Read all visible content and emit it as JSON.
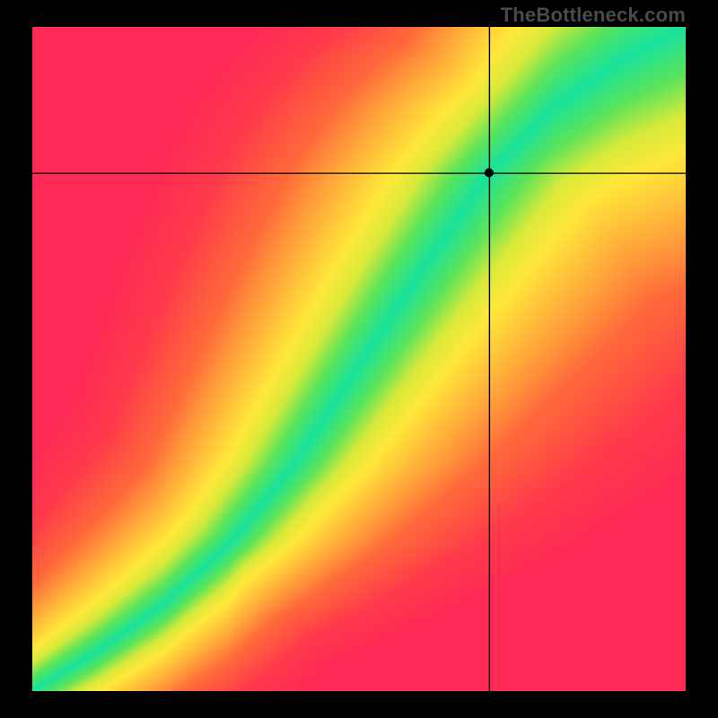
{
  "watermark": {
    "text": "TheBottleneck.com"
  },
  "chart_data": {
    "type": "heatmap",
    "title": "",
    "xlabel": "",
    "ylabel": "",
    "x_range": [
      0,
      1
    ],
    "y_range": [
      0,
      1
    ],
    "grid": false,
    "legend": false,
    "crosshair": {
      "x": 0.7,
      "y": 0.78
    },
    "marker": {
      "x": 0.7,
      "y": 0.78,
      "shape": "circle",
      "color": "#000000"
    },
    "ridge_curve_description": "Optimal match curve starts at origin, bends upward with GPU/CPU tradeoff, forming a diagonal green corridor widening toward upper right.",
    "color_scale": {
      "name": "bottleneck-red-yellow-green",
      "stops": [
        {
          "distance": 0.0,
          "color": "#18e29c"
        },
        {
          "distance": 0.06,
          "color": "#5ae45a"
        },
        {
          "distance": 0.12,
          "color": "#d7e93a"
        },
        {
          "distance": 0.18,
          "color": "#ffe83a"
        },
        {
          "distance": 0.28,
          "color": "#ffb83a"
        },
        {
          "distance": 0.45,
          "color": "#ff6a3a"
        },
        {
          "distance": 0.7,
          "color": "#ff3a4a"
        },
        {
          "distance": 1.0,
          "color": "#ff2a55"
        }
      ]
    },
    "resolution": {
      "width_cells": 128,
      "height_cells": 128
    },
    "ridge_samples": [
      {
        "x": 0.0,
        "y": 0.0
      },
      {
        "x": 0.1,
        "y": 0.06
      },
      {
        "x": 0.2,
        "y": 0.13
      },
      {
        "x": 0.3,
        "y": 0.22
      },
      {
        "x": 0.4,
        "y": 0.34
      },
      {
        "x": 0.5,
        "y": 0.49
      },
      {
        "x": 0.6,
        "y": 0.64
      },
      {
        "x": 0.7,
        "y": 0.78
      },
      {
        "x": 0.8,
        "y": 0.88
      },
      {
        "x": 0.9,
        "y": 0.95
      },
      {
        "x": 1.0,
        "y": 1.0
      }
    ]
  }
}
